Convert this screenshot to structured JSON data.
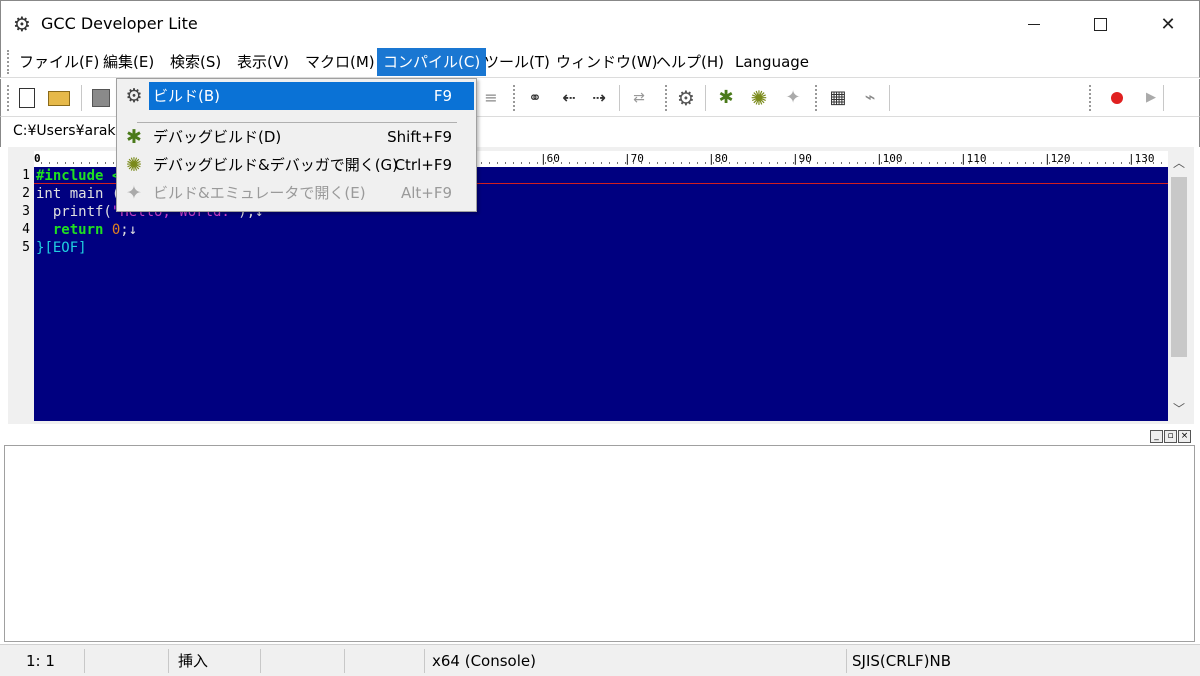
{
  "window": {
    "title": "GCC Developer Lite",
    "min_glyph": "",
    "max_glyph": "",
    "close_glyph": "✕"
  },
  "menubar": {
    "items": [
      {
        "label": "ファイル(F)"
      },
      {
        "label": "編集(E)"
      },
      {
        "label": "検索(S)"
      },
      {
        "label": "表示(V)"
      },
      {
        "label": "マクロ(M)"
      },
      {
        "label": "コンパイル(C)",
        "active": true
      },
      {
        "label": "ツール(T)"
      },
      {
        "label": "ウィンドウ(W)"
      },
      {
        "label": "ヘルプ(H)"
      },
      {
        "label": "Language"
      }
    ]
  },
  "compile_menu": {
    "items": [
      {
        "icon": "gear-icon",
        "label": "ビルド(B)",
        "shortcut": "F9",
        "state": "highlighted"
      },
      {
        "icon": "bug-icon",
        "label": "デバッグビルド(D)",
        "shortcut": "Shift+F9",
        "state": "enabled"
      },
      {
        "icon": "bug-gear-icon",
        "label": "デバッグビルド&デバッガで開く(G)",
        "shortcut": "Ctrl+F9",
        "state": "enabled"
      },
      {
        "icon": "runner-icon",
        "label": "ビルド&エミュレータで開く(E)",
        "shortcut": "Alt+F9",
        "state": "disabled"
      }
    ]
  },
  "path": {
    "text": "C:¥Users¥arak"
  },
  "ruler": {
    "start_mark": "0",
    "marks": [
      "60",
      "70",
      "80",
      "90",
      "100",
      "110",
      "120",
      "130"
    ]
  },
  "editor": {
    "line_numbers": [
      "1",
      "2",
      "3",
      "4",
      "5"
    ],
    "lines": {
      "l1_a": "#include <",
      "l2_a": "int main (",
      "l3_a": "  printf(",
      "l3_b": "\"Hello, World.\"",
      "l3_c": ");↓",
      "l4_a": "  return",
      "l4_b": " 0",
      "l4_c": ";↓",
      "l5_a": "}",
      "l5_b": "[EOF]"
    }
  },
  "statusbar": {
    "position": "1:  1",
    "mode": "挿入",
    "target": "x64 (Console)",
    "encoding": "SJIS(CRLF)NB"
  },
  "icons": {
    "app": "gear-icon",
    "toolbar": [
      "new-file-icon",
      "open-folder-icon",
      "save-icon",
      "find-icon",
      "find-prev-icon",
      "find-next-icon",
      "replace-icon",
      "build-gear-icon",
      "debug-bug-icon",
      "debug-bug-gear-icon",
      "emulator-runner-icon",
      "chip-icon",
      "plug-icon",
      "record-icon",
      "play-icon"
    ]
  },
  "colors": {
    "menu_active": "#1a77d2",
    "editor_bg": "#000080",
    "keyword": "#20e020",
    "string": "#d040d0",
    "record": "#e02020"
  }
}
